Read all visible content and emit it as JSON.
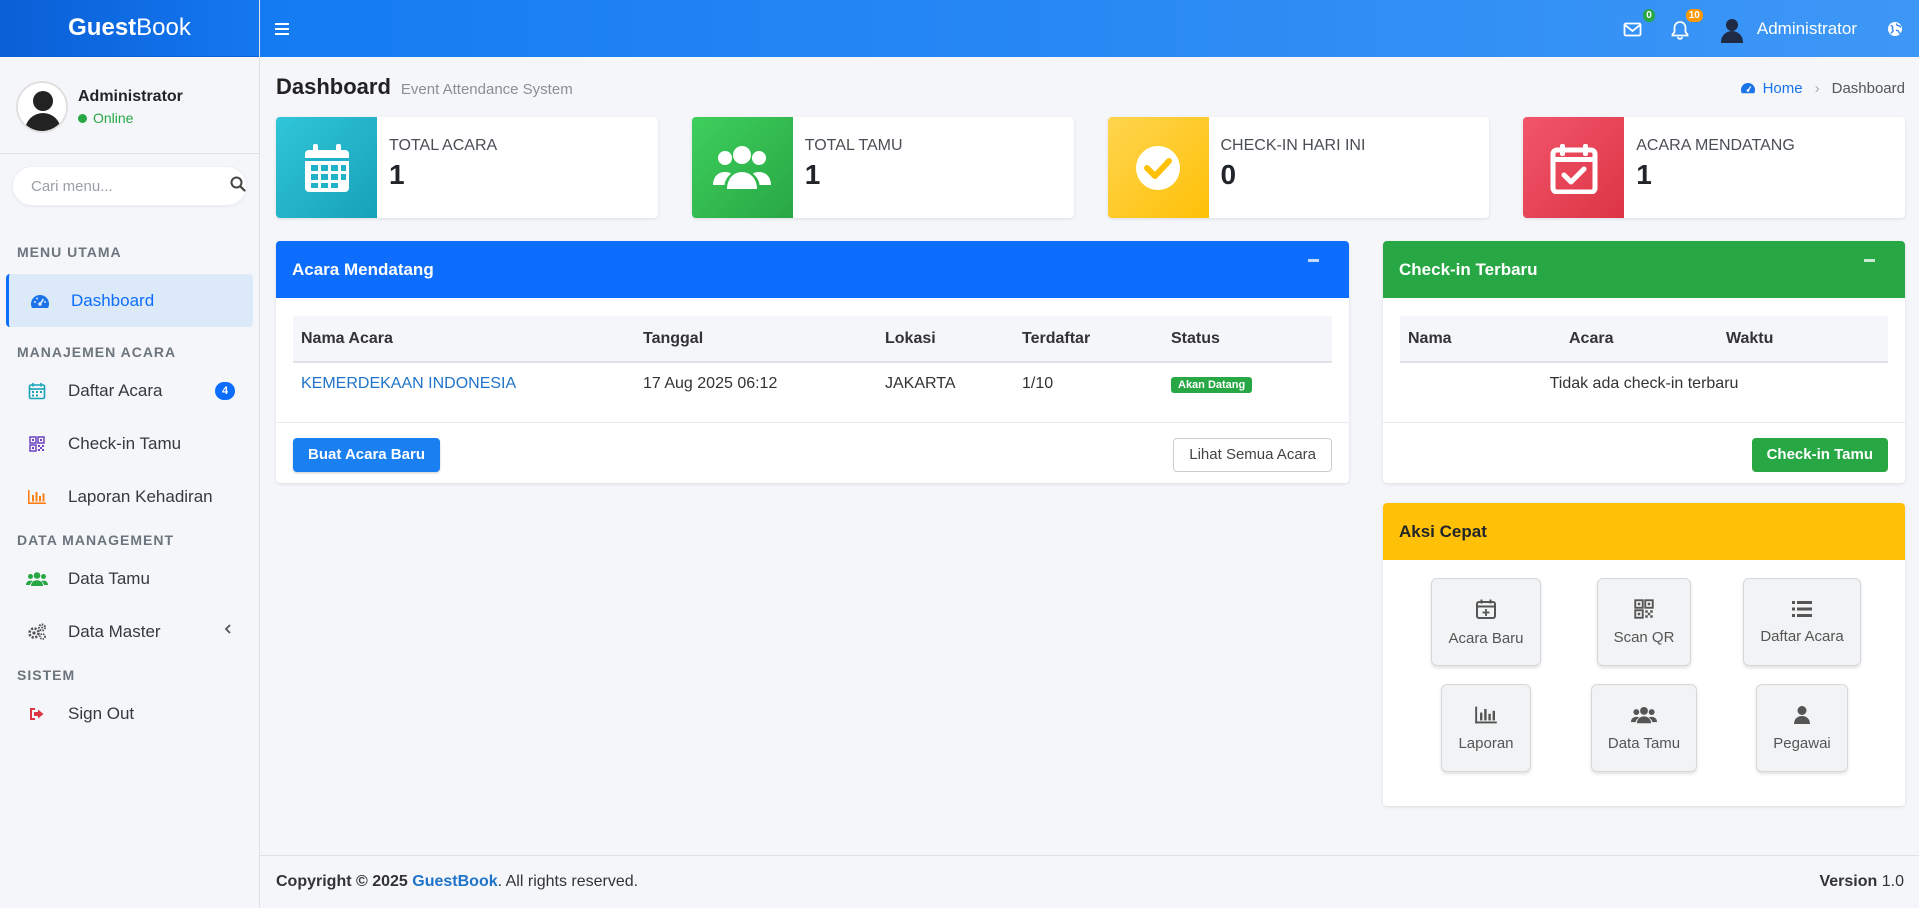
{
  "brand": {
    "bold": "Guest",
    "light": "Book"
  },
  "user": {
    "name": "Administrator",
    "status": "Online"
  },
  "search": {
    "placeholder": "Cari menu..."
  },
  "nav": {
    "headers": [
      "MENU UTAMA",
      "MANAJEMEN ACARA",
      "DATA MANAGEMENT",
      "SISTEM"
    ],
    "dashboard": "Dashboard",
    "daftar_acara": "Daftar Acara",
    "daftar_acara_badge": "4",
    "checkin_tamu": "Check-in Tamu",
    "laporan": "Laporan Kehadiran",
    "data_tamu": "Data Tamu",
    "data_master": "Data Master",
    "sign_out": "Sign Out"
  },
  "topbar": {
    "mail_count": "0",
    "bell_count": "10",
    "user": "Administrator"
  },
  "page": {
    "title": "Dashboard",
    "subtitle": "Event Attendance System"
  },
  "breadcrumb": {
    "home": "Home",
    "current": "Dashboard"
  },
  "info_boxes": [
    {
      "label": "TOTAL ACARA",
      "value": "1"
    },
    {
      "label": "TOTAL TAMU",
      "value": "1"
    },
    {
      "label": "CHECK-IN HARI INI",
      "value": "0"
    },
    {
      "label": "ACARA MENDATANG",
      "value": "1"
    }
  ],
  "acara_card": {
    "title": "Acara Mendatang",
    "columns": [
      "Nama Acara",
      "Tanggal",
      "Lokasi",
      "Terdaftar",
      "Status"
    ],
    "rows": [
      {
        "nama": "KEMERDEKAAN INDONESIA",
        "tanggal": "17 Aug 2025 06:12",
        "lokasi": "JAKARTA",
        "terdaftar": "1/10",
        "status": "Akan Datang"
      }
    ],
    "btn_new": "Buat Acara Baru",
    "btn_all": "Lihat Semua Acara"
  },
  "checkin_card": {
    "title": "Check-in Terbaru",
    "columns": [
      "Nama",
      "Acara",
      "Waktu"
    ],
    "empty": "Tidak ada check-in terbaru",
    "btn": "Check-in Tamu"
  },
  "quick_card": {
    "title": "Aksi Cepat",
    "items": [
      "Acara Baru",
      "Scan QR",
      "Daftar Acara",
      "Laporan",
      "Data Tamu",
      "Pegawai"
    ]
  },
  "footer": {
    "copyright": "Copyright © 2025",
    "brand": "GuestBook",
    "rights": ". All rights reserved.",
    "version_label": "Version",
    "version": "1.0"
  },
  "colors": {
    "primary": "#0d6efd",
    "success": "#28a745",
    "warning": "#ffc107",
    "danger": "#dc3545",
    "info": "#17a2b8"
  }
}
